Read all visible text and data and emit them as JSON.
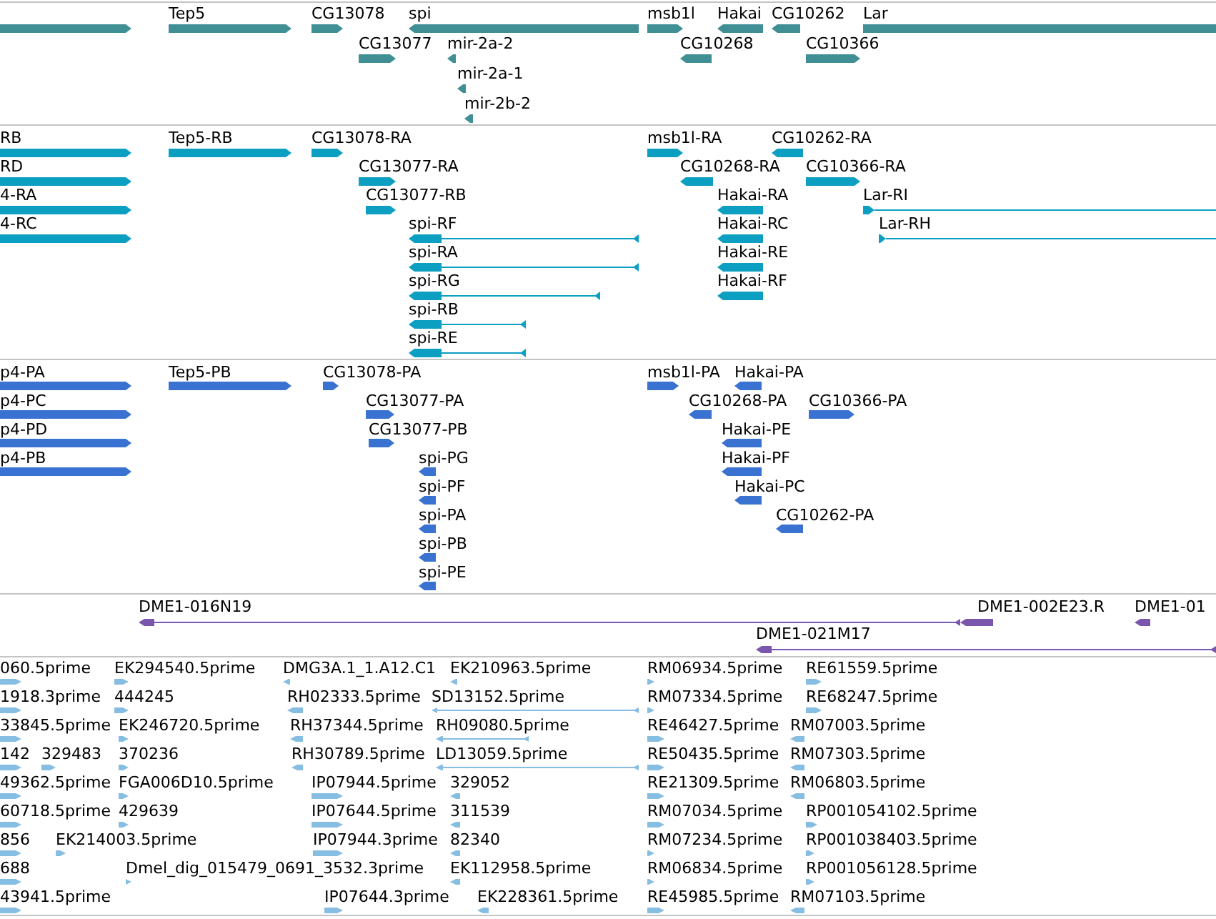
{
  "tracks": [
    {
      "features": [
        {
          "kind": "forward"
        },
        {
          "label": "Tep5",
          "kind": "forward"
        },
        {
          "label": "CG13078",
          "kind": "forward"
        },
        {
          "label": "spi",
          "kind": "reverse"
        },
        {
          "label": "msb1l",
          "kind": "forward"
        },
        {
          "label": "Hakai",
          "kind": "reverse"
        },
        {
          "label": "CG10262",
          "kind": "reverse"
        },
        {
          "label": "Lar"
        },
        {
          "label": "CG13077",
          "kind": "forward"
        },
        {
          "label": "mir-2a-2",
          "kind": "reverse"
        },
        {
          "label": "CG10268",
          "kind": "reverse"
        },
        {
          "label": "CG10366",
          "kind": "forward"
        },
        {
          "label": "mir-2a-1",
          "kind": "reverse"
        },
        {
          "label": "mir-2b-2",
          "kind": "reverse"
        }
      ]
    },
    {
      "features": [
        {
          "label": "RB",
          "kind": "forward"
        },
        {
          "label": "Tep5-RB",
          "kind": "forward"
        },
        {
          "label": "CG13078-RA",
          "kind": "forward"
        },
        {
          "label": "msb1l-RA",
          "kind": "forward"
        },
        {
          "label": "CG10262-RA",
          "kind": "reverse"
        },
        {
          "label": "RD",
          "kind": "forward"
        },
        {
          "label": "CG13077-RA",
          "kind": "forward"
        },
        {
          "label": "CG10268-RA",
          "kind": "reverse"
        },
        {
          "label": "CG10366-RA",
          "kind": "forward"
        },
        {
          "label": "4-RA",
          "kind": "forward"
        },
        {
          "label": "CG13077-RB",
          "kind": "forward"
        },
        {
          "label": "Hakai-RA",
          "kind": "reverse"
        },
        {
          "label": "Lar-RI",
          "kind": "forward"
        },
        {
          "label": "4-RC",
          "kind": "forward"
        },
        {
          "label": "spi-RF",
          "kind": "reverse"
        },
        {
          "label": "Hakai-RC",
          "kind": "reverse"
        },
        {
          "label": "Lar-RH",
          "kind": "forward"
        },
        {
          "label": "spi-RA",
          "kind": "reverse"
        },
        {
          "label": "Hakai-RE",
          "kind": "reverse"
        },
        {
          "label": "spi-RG",
          "kind": "reverse"
        },
        {
          "label": "Hakai-RF",
          "kind": "reverse"
        },
        {
          "label": "spi-RB",
          "kind": "reverse"
        },
        {
          "label": "spi-RE",
          "kind": "reverse"
        }
      ]
    },
    {
      "features": [
        {
          "label": "p4-PA",
          "kind": "forward"
        },
        {
          "label": "Tep5-PB",
          "kind": "forward"
        },
        {
          "label": "CG13078-PA",
          "kind": "forward"
        },
        {
          "label": "msb1l-PA",
          "kind": "forward"
        },
        {
          "label": "Hakai-PA",
          "kind": "reverse"
        },
        {
          "label": "p4-PC",
          "kind": "forward"
        },
        {
          "label": "CG13077-PA",
          "kind": "forward"
        },
        {
          "label": "CG10268-PA",
          "kind": "reverse"
        },
        {
          "label": "CG10366-PA",
          "kind": "forward"
        },
        {
          "label": "p4-PD",
          "kind": "forward"
        },
        {
          "label": "CG13077-PB",
          "kind": "forward"
        },
        {
          "label": "Hakai-PE",
          "kind": "reverse"
        },
        {
          "label": "p4-PB",
          "kind": "forward"
        },
        {
          "label": "spi-PG",
          "kind": "reverse"
        },
        {
          "label": "Hakai-PF",
          "kind": "reverse"
        },
        {
          "label": "spi-PF",
          "kind": "reverse"
        },
        {
          "label": "Hakai-PC",
          "kind": "reverse"
        },
        {
          "label": "spi-PA",
          "kind": "reverse"
        },
        {
          "label": "CG10262-PA",
          "kind": "reverse"
        },
        {
          "label": "spi-PB",
          "kind": "reverse"
        },
        {
          "label": "spi-PE",
          "kind": "reverse"
        }
      ]
    },
    {
      "features": [
        {
          "label": "DME1-016N19",
          "kind": "reverse"
        },
        {
          "label": "DME1-002E23.R",
          "kind": "reverse"
        },
        {
          "label": "DME1-01",
          "kind": "reverse"
        },
        {
          "label": "DME1-021M17",
          "kind": "reverse"
        }
      ]
    },
    {
      "features": [
        {
          "label": "060.5prime",
          "kind": "forward"
        },
        {
          "label": "EK294540.5prime",
          "kind": "forward"
        },
        {
          "label": "DMG3A.1_1.A12.C1",
          "kind": "reverse"
        },
        {
          "label": "EK210963.5prime",
          "kind": "reverse"
        },
        {
          "label": "RM06934.5prime",
          "kind": "forward"
        },
        {
          "label": "RE61559.5prime",
          "kind": "forward"
        },
        {
          "label": "1918.3prime",
          "kind": "forward"
        },
        {
          "label": "444245",
          "kind": "forward"
        },
        {
          "label": "RH02333.5prime",
          "kind": "reverse"
        },
        {
          "label": "SD13152.5prime",
          "kind": "reverse"
        },
        {
          "label": "RM07334.5prime",
          "kind": "forward"
        },
        {
          "label": "RE68247.5prime",
          "kind": "forward"
        },
        {
          "label": "33845.5prime",
          "kind": "forward"
        },
        {
          "label": "EK246720.5prime",
          "kind": "forward"
        },
        {
          "label": "RH37344.5prime",
          "kind": "reverse"
        },
        {
          "label": "RH09080.5prime",
          "kind": "reverse"
        },
        {
          "label": "RE46427.5prime",
          "kind": "forward"
        },
        {
          "label": "RM07003.5prime",
          "kind": "reverse"
        },
        {
          "label": "142",
          "kind": "forward"
        },
        {
          "label": "329483",
          "kind": "forward"
        },
        {
          "label": "370236",
          "kind": "forward"
        },
        {
          "label": "RH30789.5prime",
          "kind": "reverse"
        },
        {
          "label": "LD13059.5prime",
          "kind": "reverse"
        },
        {
          "label": "RE50435.5prime",
          "kind": "forward"
        },
        {
          "label": "RM07303.5prime",
          "kind": "reverse"
        },
        {
          "label": "49362.5prime",
          "kind": "forward"
        },
        {
          "label": "FGA006D10.5prime",
          "kind": "forward"
        },
        {
          "label": "IP07944.5prime",
          "kind": "forward"
        },
        {
          "label": "329052",
          "kind": "reverse"
        },
        {
          "label": "RE21309.5prime",
          "kind": "forward"
        },
        {
          "label": "RM06803.5prime",
          "kind": "reverse"
        },
        {
          "label": "60718.5prime",
          "kind": "forward"
        },
        {
          "label": "429639",
          "kind": "forward"
        },
        {
          "label": "IP07644.5prime",
          "kind": "forward"
        },
        {
          "label": "311539",
          "kind": "reverse"
        },
        {
          "label": "RM07034.5prime",
          "kind": "forward"
        },
        {
          "label": "RP001054102.5prime",
          "kind": "forward"
        },
        {
          "label": "856",
          "kind": "forward"
        },
        {
          "label": "EK214003.5prime",
          "kind": "forward"
        },
        {
          "label": "IP07944.3prime",
          "kind": "forward"
        },
        {
          "label": "82340",
          "kind": "reverse"
        },
        {
          "label": "RM07234.5prime",
          "kind": "forward"
        },
        {
          "label": "RP001038403.5prime",
          "kind": "forward"
        },
        {
          "label": "688",
          "kind": "forward"
        },
        {
          "label": "Dmel_dig_015479_0691_3532.3prime",
          "kind": "forward"
        },
        {
          "label": "EK112958.5prime",
          "kind": "reverse"
        },
        {
          "label": "RM06834.5prime",
          "kind": "forward"
        },
        {
          "label": "RP001056128.5prime",
          "kind": "forward"
        },
        {
          "label": "43941.5prime",
          "kind": "forward"
        },
        {
          "label": "IP07644.3prime",
          "kind": "forward"
        },
        {
          "label": "EK228361.5prime",
          "kind": "reverse"
        },
        {
          "label": "RE45985.5prime",
          "kind": "forward"
        },
        {
          "label": "RM07103.5prime",
          "kind": "reverse"
        }
      ]
    }
  ]
}
